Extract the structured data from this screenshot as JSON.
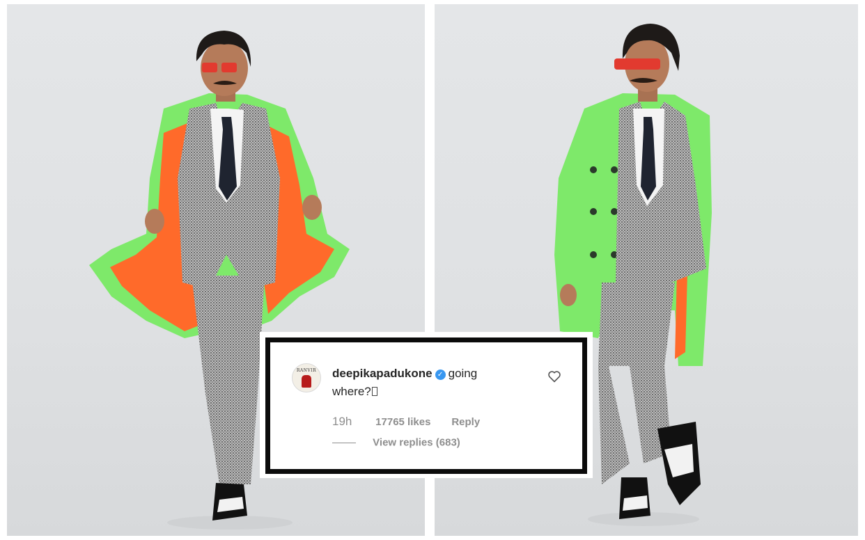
{
  "comment": {
    "avatar_text": "RANVIR",
    "username": "deepikapadukone",
    "verified_icon": "verified-check-icon",
    "text_line1": "going",
    "text_line2": "where?",
    "emoji_placeholder_icon": "missing-glyph-box-icon",
    "like_icon": "heart-outline-icon",
    "timestamp": "19h",
    "likes": "17765 likes",
    "reply_label": "Reply",
    "view_replies": "View replies (683)"
  },
  "colors": {
    "coat_green": "#7ee96a",
    "coat_lining_orange": "#ff6a2a",
    "verified_blue": "#3897f0",
    "frame_black": "#0b0b0b",
    "meta_gray": "#8e8e8e"
  }
}
